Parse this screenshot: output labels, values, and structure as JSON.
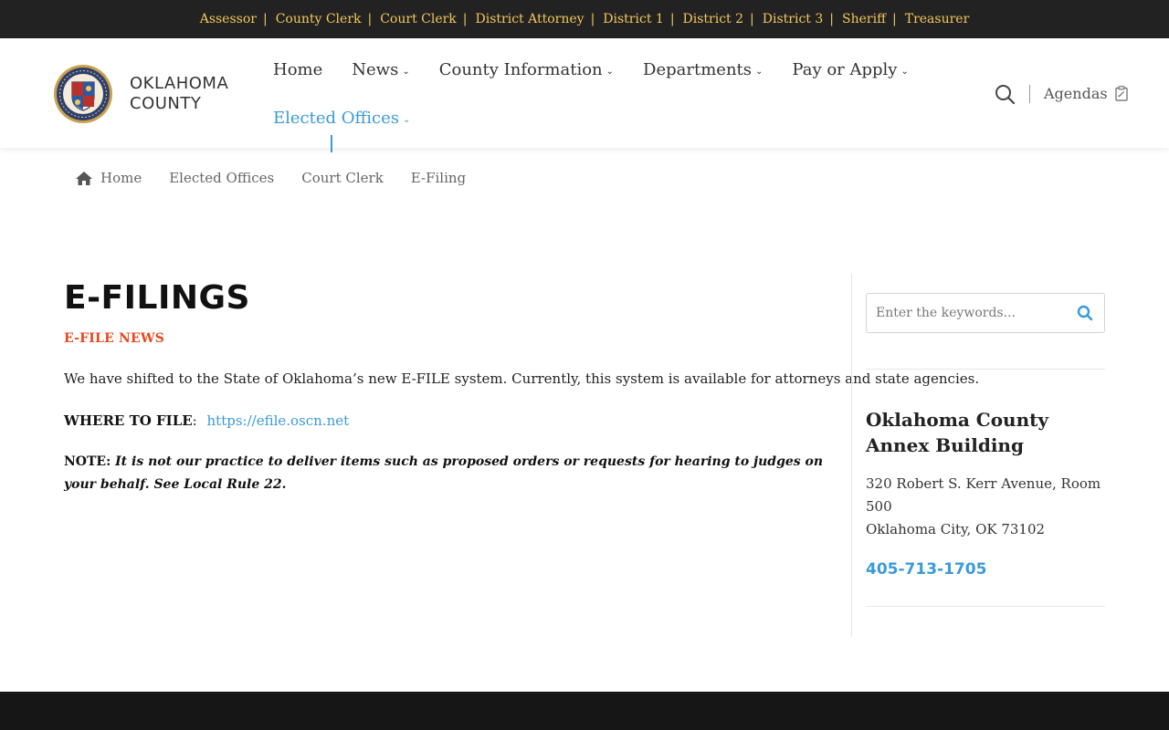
{
  "top_links": [
    "Assessor",
    "County Clerk",
    "Court Clerk",
    "District Attorney",
    "District 1",
    "District 2",
    "District 3",
    "Sheriff",
    "Treasurer"
  ],
  "top_separator": "|",
  "logo": {
    "line1": "OKLAHOMA",
    "line2": "COUNTY"
  },
  "nav": {
    "home": "Home",
    "news": "News",
    "county_information": "County Information",
    "departments": "Departments",
    "pay_or_apply": "Pay or Apply",
    "elected_offices": "Elected Offices",
    "chevron": "⌄"
  },
  "header": {
    "agendas": "Agendas"
  },
  "breadcrumb": {
    "home": "Home",
    "elected_offices": "Elected Offices",
    "court_clerk": "Court Clerk",
    "current": "E-Filing"
  },
  "main": {
    "title": "E-FILINGS",
    "news_heading": "E-FILE NEWS",
    "paragraph": "We have shifted to the State of Oklahoma’s new E-FILE system. Currently, this system is available for attorneys and state agencies.",
    "where_label": "WHERE TO FILE",
    "where_colon": ":",
    "where_link": "https://efile.oscn.net",
    "note_label": "NOTE:",
    "note_text": "It is not our practice to deliver items such as proposed orders or requests for hearing to judges on your behalf. See Local Rule 22."
  },
  "sidebar": {
    "search_placeholder": "Enter the keywords...",
    "building_title": "Oklahoma County Annex Building",
    "address_line1": "320 Robert S. Kerr Avenue, Room 500",
    "address_line2": "Oklahoma City, OK 73102",
    "phone": "405-713-1705"
  },
  "colors": {
    "top_bar": "#222222",
    "top_link": "#f2c75c",
    "accent_blue": "#3b9ad9",
    "news_orange": "#e8481e",
    "footer": "#161616"
  },
  "icons": [
    "county-seal-icon",
    "search-icon",
    "clipboard-icon",
    "home-icon",
    "chevron-down-icon"
  ]
}
